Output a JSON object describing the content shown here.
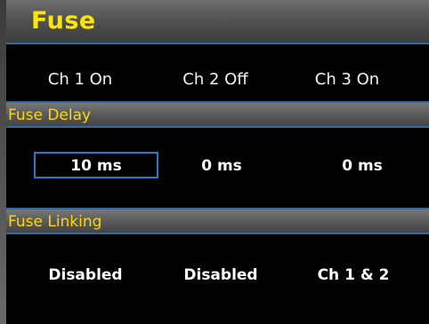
{
  "title": "Fuse",
  "channels": [
    "Ch 1 On",
    "Ch 2 Off",
    "Ch 3 On"
  ],
  "fuse_delay": {
    "label": "Fuse Delay",
    "values": [
      "10 ms",
      "0 ms",
      "0 ms"
    ],
    "selected_index": 0
  },
  "fuse_linking": {
    "label": "Fuse Linking",
    "values": [
      "Disabled",
      "Disabled",
      "Ch 1 & 2"
    ]
  },
  "colors": {
    "accent_yellow": "#ffe600",
    "highlight_blue": "#2c78c8",
    "background": "#000000"
  }
}
